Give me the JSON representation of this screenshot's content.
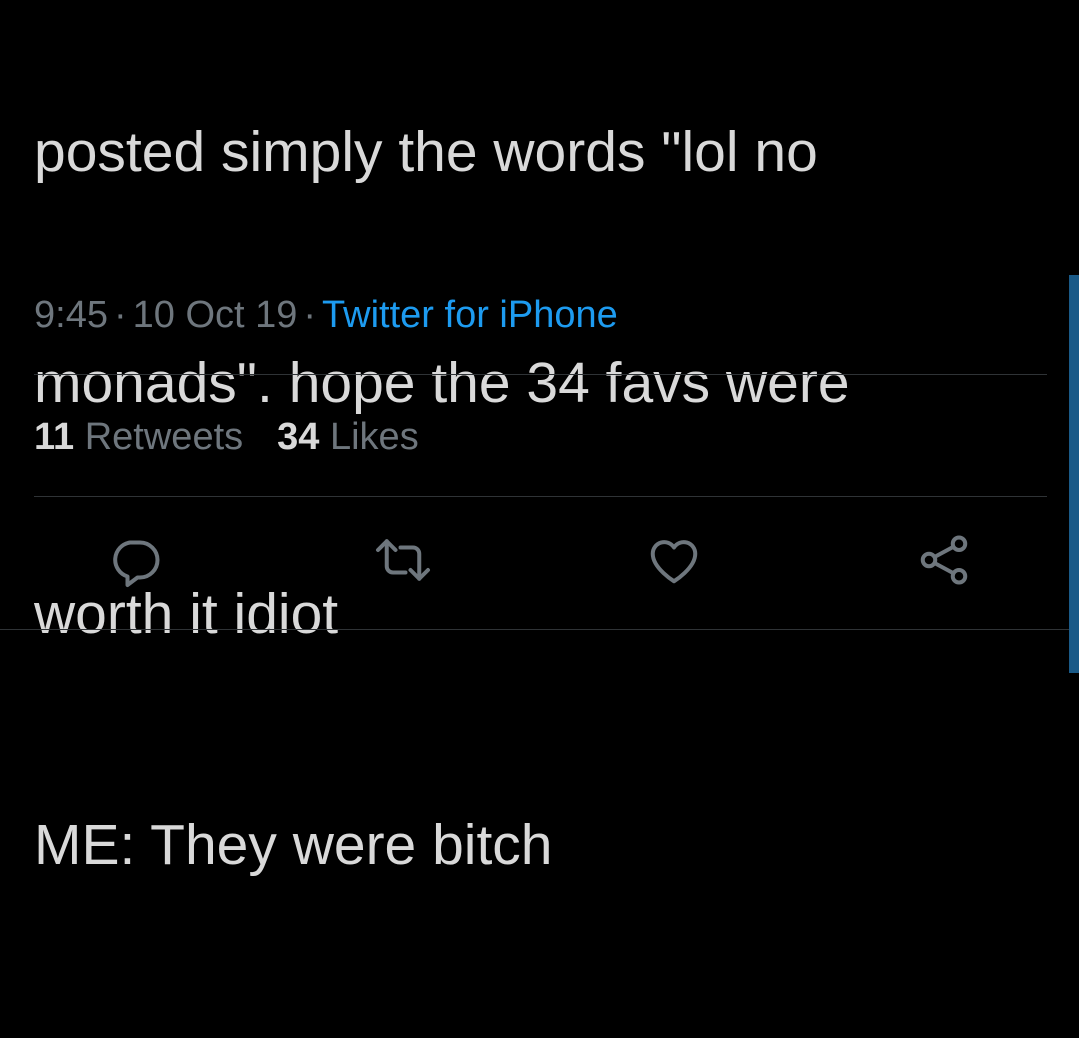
{
  "tweet": {
    "text_lines": [
      "posted simply the words \"lol no",
      "monads\". hope the 34 favs were",
      "worth it idiot",
      "ME: They were bitch"
    ],
    "time": "9:45",
    "date": "10 Oct 19",
    "separator": "·",
    "source": "Twitter for iPhone"
  },
  "stats": {
    "retweets_count": "11",
    "retweets_label": "Retweets",
    "likes_count": "34",
    "likes_label": "Likes"
  },
  "actions": [
    {
      "icon": "reply-icon"
    },
    {
      "icon": "retweet-icon"
    },
    {
      "icon": "like-icon"
    },
    {
      "icon": "share-icon"
    }
  ],
  "colors": {
    "background": "#000000",
    "text": "#d9d9d9",
    "muted": "#6e767d",
    "accent": "#1d9bf0",
    "divider": "#2f3336",
    "icon": "#6e767d"
  }
}
